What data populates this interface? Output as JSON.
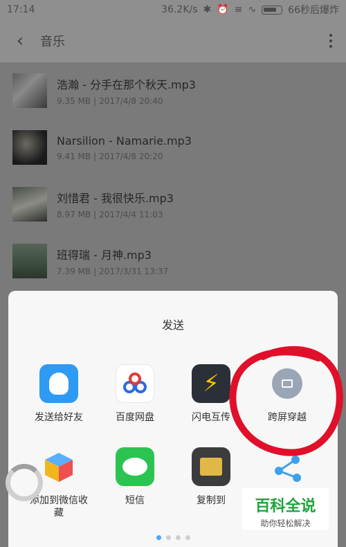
{
  "status_bar": {
    "time": "17:14",
    "net_speed": "36.2K/s",
    "battery_text": "66秒后爆炸"
  },
  "header": {
    "title": "音乐"
  },
  "files": [
    {
      "name": "浩瀚 - 分手在那个秋天.mp3",
      "size": "9.35 MB",
      "date": "2017/4/8 20:40"
    },
    {
      "name": "Narsilion - Namarie.mp3",
      "size": "9.41 MB",
      "date": "2017/4/8 20:20"
    },
    {
      "name": "刘惜君 - 我很快乐.mp3",
      "size": "8.97 MB",
      "date": "2017/4/4 11:03"
    },
    {
      "name": "班得瑞 - 月神.mp3",
      "size": "7.39 MB",
      "date": "2017/3/31 13:37"
    }
  ],
  "share_sheet": {
    "title": "发送",
    "apps": [
      {
        "label": "发送给好友",
        "icon": "qq-icon"
      },
      {
        "label": "百度网盘",
        "icon": "baidu-pan-icon"
      },
      {
        "label": "闪电互传",
        "icon": "flash-transfer-icon"
      },
      {
        "label": "跨屏穿越",
        "icon": "cross-screen-icon"
      },
      {
        "label": "添加到微信收藏",
        "icon": "wechat-favorite-icon"
      },
      {
        "label": "短信",
        "icon": "sms-icon"
      },
      {
        "label": "复制到",
        "icon": "copy-to-icon"
      },
      {
        "label": "",
        "icon": "es-share-icon"
      }
    ],
    "page_count": 4,
    "active_page": 1
  },
  "watermark": {
    "title": "百科全说",
    "subtitle": "助你轻松解决"
  },
  "colors": {
    "accent_dot": "#48a6ff",
    "annotation_red": "#e0102a"
  }
}
